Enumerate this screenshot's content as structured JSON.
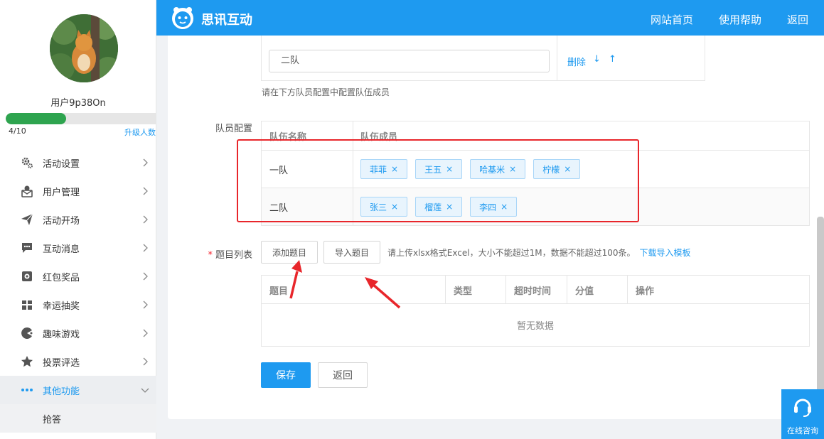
{
  "sidebar": {
    "username": "用户9p38On",
    "quota": "4/10",
    "quota_fraction": 0.4,
    "upgrade_label": "升级人数",
    "menu": [
      {
        "label": "活动设置",
        "icon": "gear-icon"
      },
      {
        "label": "用户管理",
        "icon": "user-icon"
      },
      {
        "label": "活动开场",
        "icon": "paper-plane-icon"
      },
      {
        "label": "互动消息",
        "icon": "message-icon"
      },
      {
        "label": "红包奖品",
        "icon": "red-envelope-icon"
      },
      {
        "label": "幸运抽奖",
        "icon": "gift-icon"
      },
      {
        "label": "趣味游戏",
        "icon": "pacman-icon"
      },
      {
        "label": "投票评选",
        "icon": "star-icon"
      },
      {
        "label": "其他功能",
        "icon": "more-dots-icon"
      }
    ],
    "submenu": [
      {
        "label": "抢答"
      }
    ]
  },
  "header": {
    "brand": "思讯互动",
    "nav": [
      "网站首页",
      "使用帮助",
      "返回"
    ]
  },
  "team_config": {
    "team_input_value": "二队",
    "delete_label": "删除",
    "down_arrow": "↓",
    "up_arrow": "↑",
    "hint": "请在下方队员配置中配置队伍成员"
  },
  "member_config": {
    "label": "队员配置",
    "columns": [
      "队伍名称",
      "队伍成员"
    ],
    "rows": [
      {
        "team": "一队",
        "members": [
          "菲菲",
          "王五",
          "哈基米",
          "柠檬"
        ]
      },
      {
        "team": "二队",
        "members": [
          "张三",
          "榴莲",
          "李四"
        ]
      }
    ],
    "tag_close": "×"
  },
  "question_list": {
    "label": "题目列表",
    "required_mark": "*",
    "add_button": "添加题目",
    "import_button": "导入题目",
    "upload_hint": "请上传xlsx格式Excel，大小不能超过1M，数据不能超过100条。",
    "download_link": "下载导入模板",
    "columns": [
      "题目",
      "类型",
      "超时时间",
      "分值",
      "操作"
    ],
    "empty_text": "暂无数据"
  },
  "actions": {
    "save": "保存",
    "back": "返回"
  },
  "consult": {
    "label": "在线咨询"
  },
  "colors": {
    "primary": "#1e9af0",
    "progress": "#2ea44f",
    "annotation": "#e8262b"
  }
}
